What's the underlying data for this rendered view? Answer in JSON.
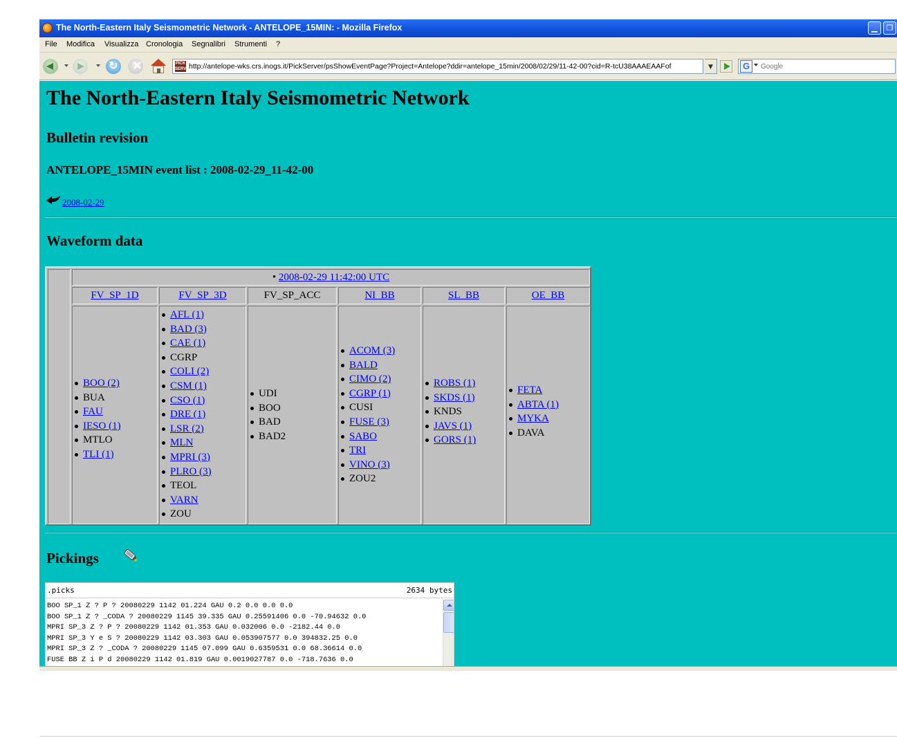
{
  "window": {
    "title": "The North-Eastern Italy Seismometric Network - ANTELOPE_15MIN: - Mozilla Firefox",
    "minimize_glyph": "▁",
    "maximize_glyph": "❐"
  },
  "menu": [
    "File",
    "Modifica",
    "Visualizza",
    "Cronologia",
    "Segnalibri",
    "Strumenti",
    "?"
  ],
  "navbar": {
    "url": "http://antelope-wks.crs.inogs.it/PickServer/psShowEventPage?Project=Antelope?ddir=antelope_15min/2008/02/29/11-42-00?cid=R-tcU38AAAEAAFof",
    "site_icon_text": "PICK SERV",
    "search_engine_letter": "G",
    "search_placeholder": "Google",
    "icons": [
      "back-icon",
      "forward-icon",
      "reload-icon",
      "stop-icon",
      "home-icon",
      "go-icon"
    ]
  },
  "page": {
    "title": "The North-Eastern Italy Seismometric Network",
    "subtitle": "Bulletin revision",
    "event_list": "ANTELOPE_15MIN event list : 2008-02-29_11-42-00",
    "back_link": "2008-02-29",
    "waveform_heading": "Waveform data",
    "pickings_heading": "Pickings"
  },
  "waveform": {
    "time_link": "2008-02-29 11:42:00 UTC",
    "columns": [
      {
        "name": "FV_SP_1D",
        "linked": true,
        "stations": [
          {
            "label": "BOO (2)",
            "linked": true
          },
          {
            "label": "BUA",
            "linked": false
          },
          {
            "label": "FAU",
            "linked": true
          },
          {
            "label": "IESO (1)",
            "linked": true
          },
          {
            "label": "MTLO",
            "linked": false
          },
          {
            "label": "TLI (1)",
            "linked": true
          }
        ]
      },
      {
        "name": "FV_SP_3D",
        "linked": true,
        "stations": [
          {
            "label": "AFL (1)",
            "linked": true
          },
          {
            "label": "BAD (3)",
            "linked": true
          },
          {
            "label": "CAE (1)",
            "linked": true
          },
          {
            "label": "CGRP",
            "linked": false
          },
          {
            "label": "COLI (2)",
            "linked": true
          },
          {
            "label": "CSM (1)",
            "linked": true
          },
          {
            "label": "CSO (1)",
            "linked": true
          },
          {
            "label": "DRE (1)",
            "linked": true
          },
          {
            "label": "LSR (2)",
            "linked": true
          },
          {
            "label": "MLN",
            "linked": true
          },
          {
            "label": "MPRI (3)",
            "linked": true
          },
          {
            "label": "PLRO (3)",
            "linked": true
          },
          {
            "label": "TEOL",
            "linked": false
          },
          {
            "label": "VARN",
            "linked": true
          },
          {
            "label": "ZOU",
            "linked": false
          }
        ]
      },
      {
        "name": "FV_SP_ACC",
        "linked": false,
        "stations": [
          {
            "label": "UDI",
            "linked": false
          },
          {
            "label": "BOO",
            "linked": false
          },
          {
            "label": "BAD",
            "linked": false
          },
          {
            "label": "BAD2",
            "linked": false
          }
        ]
      },
      {
        "name": "NI_BB",
        "linked": true,
        "stations": [
          {
            "label": "ACOM (3)",
            "linked": true
          },
          {
            "label": "BALD",
            "linked": true
          },
          {
            "label": "CIMO (2)",
            "linked": true
          },
          {
            "label": "CGRP (1)",
            "linked": true
          },
          {
            "label": "CUSI",
            "linked": false
          },
          {
            "label": "FUSE (3)",
            "linked": true
          },
          {
            "label": "SABO",
            "linked": true
          },
          {
            "label": "TRI",
            "linked": true
          },
          {
            "label": "VINO (3)",
            "linked": true
          },
          {
            "label": "ZOU2",
            "linked": false
          }
        ]
      },
      {
        "name": "SL_BB",
        "linked": true,
        "stations": [
          {
            "label": "ROBS (1)",
            "linked": true
          },
          {
            "label": "SKDS (1)",
            "linked": true
          },
          {
            "label": "KNDS",
            "linked": false
          },
          {
            "label": "JAVS (1)",
            "linked": true
          },
          {
            "label": "GORS (1)",
            "linked": true
          }
        ]
      },
      {
        "name": "OE_BB",
        "linked": true,
        "stations": [
          {
            "label": "FETA",
            "linked": true
          },
          {
            "label": "ABTA (1)",
            "linked": true
          },
          {
            "label": "MYKA",
            "linked": true
          },
          {
            "label": "DAVA",
            "linked": false
          }
        ]
      }
    ]
  },
  "picks": {
    "filename": ".picks",
    "size": "2634 bytes",
    "lines": [
      "BOO SP_1 Z ? P ? 20080229 1142 01.224 GAU 0.2 0.0 0.0 0.0",
      "BOO SP_1 Z ? _CODA ? 20080229 1145 39.335 GAU 0.25591406 0.0 -70.94632 0.0",
      "MPRI SP_3 Z ? P ? 20080229 1142 01.353 GAU 0.032006 0.0 -2182.44 0.0",
      "MPRI SP_3 Y e S ? 20080229 1142 03.303 GAU 0.053907577 0.0 394832.25 0.0",
      "MPRI SP_3 Z ? _CODA ? 20080229 1145 07.099 GAU 0.6359531 0.0 68.36614 0.0",
      "FUSE BB Z i P d 20080229 1142 01.819 GAU 0.0019027787 0.0 -718.7636 0.0"
    ]
  }
}
